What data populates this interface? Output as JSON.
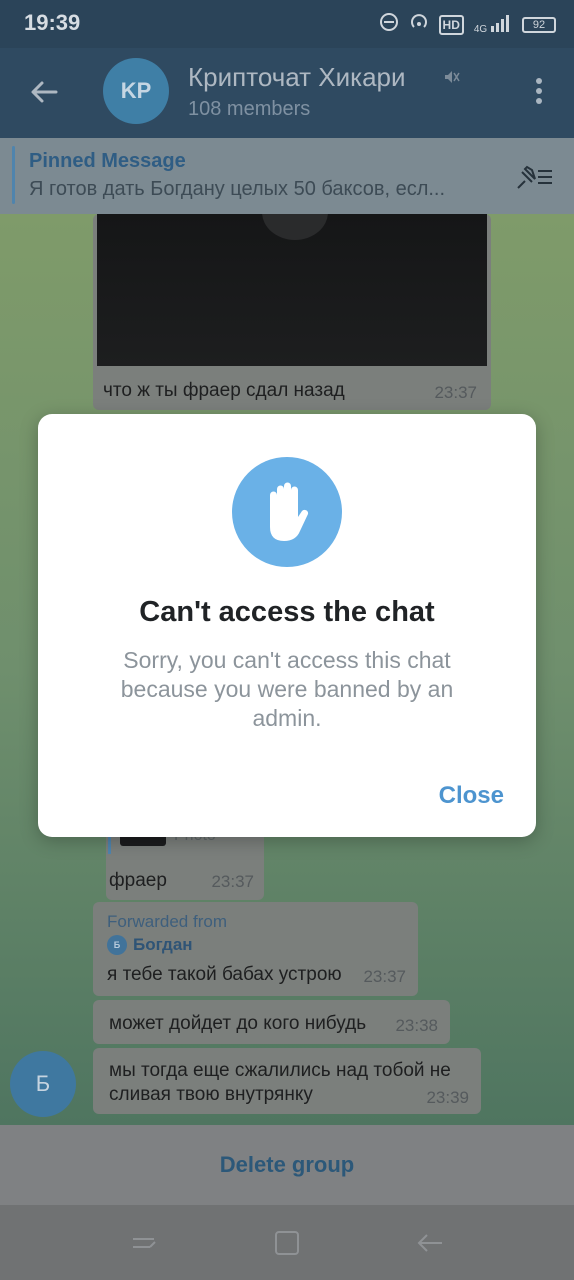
{
  "status_bar": {
    "time": "19:39",
    "network": "4G",
    "hd": "HD",
    "battery": "92"
  },
  "header": {
    "avatar_initials": "KP",
    "title": "Крипточат Хикари",
    "members": "108 members"
  },
  "pinned": {
    "title": "Pinned Message",
    "text": "Я готов дать Богдану целых 50 баксов, есл..."
  },
  "messages": [
    {
      "text": "что ж ты фраер сдал назад",
      "time": "23:37"
    },
    {
      "photo_label": "Photo",
      "text": "фраер",
      "time": "23:37"
    },
    {
      "forwarded_label": "Forwarded from",
      "forwarded_name": "Богдан",
      "forwarded_initial": "Б",
      "text": "я тебе такой бабах устрою",
      "time": "23:37"
    },
    {
      "text": "может дойдет до кого нибудь",
      "time": "23:38"
    },
    {
      "text_line1": "мы тогда еще сжалились над тобой не",
      "text_line2": "сливая твою внутрянку",
      "time": "23:39"
    }
  ],
  "sender_avatar": "Б",
  "bottom": {
    "delete_label": "Delete group"
  },
  "dialog": {
    "title": "Can't access the chat",
    "body": "Sorry, you can't access this chat because you were banned by an admin.",
    "close_label": "Close",
    "icon": "raised-hand-icon",
    "icon_color": "#6ab1e7"
  },
  "colors": {
    "header_bg": "#2f4a61",
    "accent": "#4d94cf"
  }
}
